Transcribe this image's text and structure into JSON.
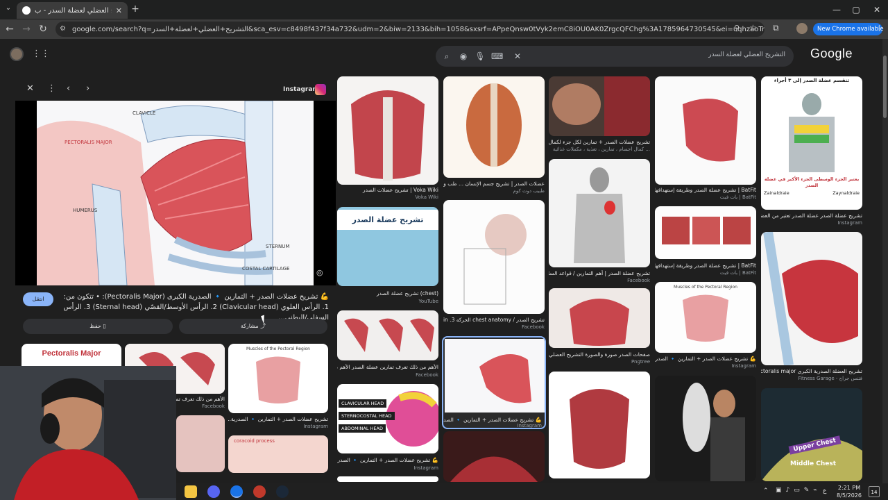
{
  "browser": {
    "tab_title": "التشريح العضلي لعضلة السدر - ب",
    "new_tab": "+",
    "url": "google.com/search?q=التشريح+العضلي+لعضلة+السدر&sca_esv=c8498f437f34a732&udm=2&biw=2133&bih=1058&sxsrf=APpeQnsw0tVyk2emC8iOU0AK0ZrgcQFChg%3A1785964730545&ei=uqhzaoTrIKnzxc8P76mMkQk&ved...",
    "new_chrome_label": "New Chrome available"
  },
  "google": {
    "logo": "Google",
    "query": "التشريح العضلي لعضلة السدر"
  },
  "panel": {
    "source": "Instagram",
    "figure_labels": [
      "CLAVICLE",
      "PECTORALIS MAJOR",
      "HUMERUS",
      "STERNUM",
      "COSTAL CARTILAGE"
    ],
    "description": "💪 تشريح عضلات الصدر + التمارين 🔹 الصدرية الكبرى (Pectoralis Major): • تتكون من: 1. الرأس العلوي (Clavicular head) 2. الرأس الأوسط/القصّي (Sternal head) 3. الرأس السفلي/البطني...",
    "visit_label": "انتقل",
    "share_label": "مشاركة",
    "save_label": "حفظ",
    "related": [
      {
        "title": "Pectoralis Major",
        "caption": "",
        "source": ""
      },
      {
        "title": "",
        "caption": "الأهم من ذلك ‏تعرف تمارين",
        "source": "Facebook"
      },
      {
        "title": "Muscles of the Pectoral Region",
        "caption": "تشريح عضلات الصدر + التمارين 🔹 الصدرية...",
        "source": "Instagram"
      },
      {
        "title": "coracoid process",
        "caption": "",
        "source": ""
      }
    ]
  },
  "results": [
    {
      "caption": "Voka Wiki | تشريح عضلات الصدر",
      "source": "Voka Wiki"
    },
    {
      "caption": "تشريح عضلة الصدر",
      "title_overlay": "تشريح عضلة الصدر",
      "caption2": "(chest) تشريح عضلة الصدر",
      "source": "YouTube"
    },
    {
      "caption": "الأهم من ذلك ‏تعرف تمارين عضلة الصدر ‏الأهم من ذلك...",
      "source": "Facebook"
    },
    {
      "labels": [
        "CLAVICULAR HEAD",
        "STERNOCOSTAL HEAD",
        "ABDOMINAL HEAD"
      ],
      "caption": "💪 تشريح عضلات الصدر + التمارين 🔹 الصدرية...",
      "source": "Instagram"
    },
    {
      "caption": "عضلات الصدر | تشريح جسم الإنسان ... طب وصحة ...",
      "source": "طبيب دوت كوم"
    },
    {
      "caption": "تشريح الصدر / chest anatomy الحركه 3. main ...",
      "source": "Facebook"
    },
    {
      "caption": "💪 تشريح عضلات الصدر + التمارين 🔹 الصدرية الكبر...",
      "source": "Instagram"
    },
    {
      "caption": "تشريح عضلات الصدر + تمارين لكل جزء لكمال الأجسام",
      "source": "كمال أجسام ، تمارين ، تغذية ، مكملات غذائية ..."
    },
    {
      "caption": "تشريح عضلة الصدر | أهم التمارين / قواعد السلامة ليس...",
      "source": "Facebook"
    },
    {
      "caption": "صفحات الصدر صورة والصورة التشريح العضلي...",
      "source": "Pngtree"
    },
    {
      "caption": "BatFit | تشريح عضلة الصدر وطريقة إستهدافها | بات فيت",
      "source": "بات فيت | BatFit"
    },
    {
      "caption": "BatFit | تشريح عضلة الصدر وطريقة إستهدافها | بات فيت",
      "source": "بات فيت | BatFit"
    },
    {
      "title": "Muscles of the Pectoral Region",
      "caption": "💪 تشريح عضلات الصدر + التمارين 🔹 الصدرية الكبر...",
      "source": "Instagram"
    },
    {
      "overlay_top": "تنقسم عضلة الصدر إلى ٣ أجزاء",
      "overlay_bottom": "يعتبر الجزء الوسطى الجزء الأكبر في عضلة الصدر",
      "handles": [
        "Zainaldraie",
        "Zaynaldraie"
      ],
      "caption": "تشريح عضلة الصدر عضلة الصدر تعتبر من العضلات...",
      "source": "Instagram"
    },
    {
      "caption": "تشريح العضلة الصدرية الكبرى Pectoralis major و...",
      "source": "Fitness Garage - فتنس جراج"
    },
    {
      "overlay": [
        "Upper Chest",
        "Middle Chest"
      ]
    }
  ],
  "taskbar": {
    "time": "2:21 PM",
    "date": "8/5/2026",
    "lang": "ع",
    "notif": "14"
  }
}
